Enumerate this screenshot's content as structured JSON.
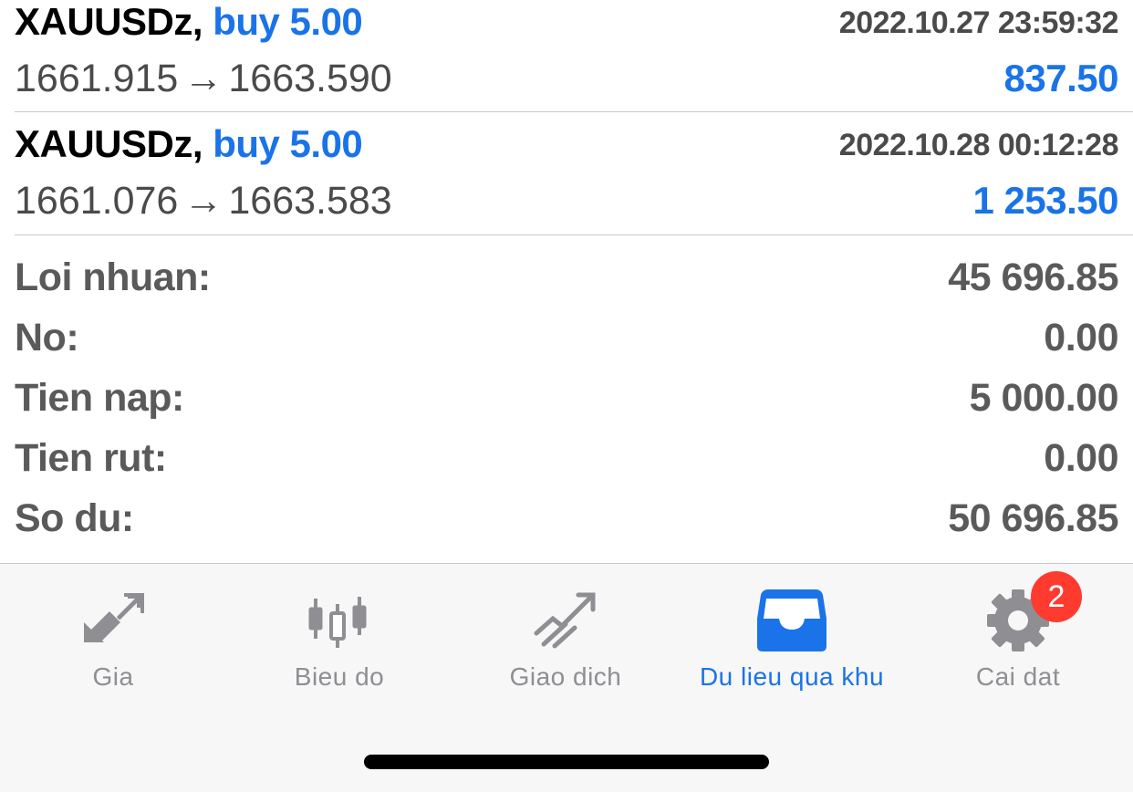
{
  "deals": [
    {
      "symbol": "XAUUSDz,",
      "type": "buy 5.00",
      "time": "2022.10.27 23:59:32",
      "open_price": "1661.915",
      "arrow": "→",
      "close_price": "1663.590",
      "profit": "837.50"
    },
    {
      "symbol": "XAUUSDz,",
      "type": "buy 5.00",
      "time": "2022.10.28 00:12:28",
      "open_price": "1661.076",
      "arrow": "→",
      "close_price": "1663.583",
      "profit": "1 253.50"
    }
  ],
  "summary": [
    {
      "label": "Loi nhuan:",
      "value": "45 696.85"
    },
    {
      "label": "No:",
      "value": "0.00"
    },
    {
      "label": "Tien nap:",
      "value": "5 000.00"
    },
    {
      "label": "Tien rut:",
      "value": "0.00"
    },
    {
      "label": "So du:",
      "value": "50 696.85"
    }
  ],
  "tabbar": {
    "tabs": [
      {
        "label": "Gia",
        "icon": "quotes-arrows-icon"
      },
      {
        "label": "Bieu do",
        "icon": "candlestick-chart-icon"
      },
      {
        "label": "Giao dich",
        "icon": "trade-trend-icon"
      },
      {
        "label": "Du lieu qua khu",
        "icon": "history-inbox-icon",
        "active": true
      },
      {
        "label": "Cai dat",
        "icon": "gear-icon",
        "badge": "2"
      }
    ]
  },
  "colors": {
    "accent": "#1a73e8",
    "text_dark": "#000000",
    "text_gray": "#5a5a5a",
    "tab_inactive": "#8e8e93",
    "badge": "#ff3b30",
    "tabbar_bg": "#f7f7f7"
  }
}
